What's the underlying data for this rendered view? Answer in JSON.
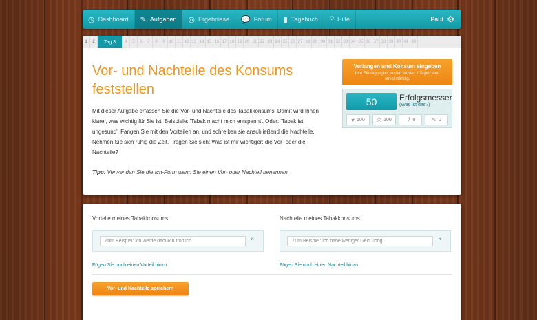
{
  "nav": {
    "items": [
      {
        "label": "Dashboard",
        "icon": "clock-icon"
      },
      {
        "label": "Aufgaben",
        "icon": "pencil-icon"
      },
      {
        "label": "Ergebnisse",
        "icon": "target-icon"
      },
      {
        "label": "Forum",
        "icon": "chat-icon"
      },
      {
        "label": "Tagebuch",
        "icon": "book-icon"
      },
      {
        "label": "Hilfe",
        "icon": "question-icon"
      }
    ],
    "active_index": 1,
    "user": "Paul"
  },
  "days": {
    "past": [
      "1",
      "2"
    ],
    "active": "Tag 3",
    "future": [
      "4",
      "5",
      "6",
      "7",
      "8",
      "9",
      "10",
      "11",
      "12",
      "13",
      "14",
      "15",
      "16",
      "17",
      "18",
      "19",
      "20",
      "21",
      "22",
      "23",
      "24",
      "25",
      "26",
      "27",
      "28",
      "29",
      "30",
      "31",
      "32",
      "33",
      "34",
      "35",
      "36",
      "37",
      "38",
      "39",
      "40",
      "41",
      "42"
    ]
  },
  "task": {
    "title": "Vor- und Nachteile des Konsums feststellen",
    "description": "Mit dieser Aufgabe erfassen Sie die Vor- und Nachteile des Tabakkonsums. Damit wird Ihnen klarer, was wichtig für Sie ist. Beispiele: 'Tabak macht mich entspannt'. Oder: 'Tabak ist ungesund'. Fangen Sie mit den Vorteilen an, und schreiben sie anschließend die Nachteile. Nehmen Sie sich ruhig die Zeit. Fragen Sie sich: Was ist mir wichtiger: die Vor- oder die Nachteile?",
    "tip_label": "Tipp:",
    "tip_text": "Verwenden Sie die Ich-Form wenn Sie einen Vor- oder Nachteil benennen."
  },
  "sidebar": {
    "cta_title": "Verlangen und Konsum eingeben",
    "cta_sub": "Ihre Eintragungen zu den letzten 2 Tagen sind unvollständig.",
    "score": "50",
    "score_title": "Erfolgsmesser",
    "score_link": "(Was ist das?)",
    "stats": [
      {
        "icon": "heart-icon",
        "value": "100"
      },
      {
        "icon": "target-icon",
        "value": "100"
      },
      {
        "icon": "chart-icon",
        "value": "0"
      },
      {
        "icon": "pencil-icon",
        "value": "0"
      }
    ]
  },
  "form": {
    "pros_title": "Vorteile meines Tabakkonsums",
    "pros_placeholder": "Zum Beispiel: ich werde dadurch fröhlich",
    "pros_add": "Fügen Sie noch einen Vorteil hinzu",
    "cons_title": "Nachteile meines Tabakkonsums",
    "cons_placeholder": "Zum Beispiel: ich habe weniger Geld übrig",
    "cons_add": "Fügen Sie noch einen Nachteil hinzu",
    "remove_symbol": "×",
    "save_label": "Vor- und Nachteile speichern"
  },
  "colors": {
    "teal": "#129aa7",
    "orange": "#f2951b"
  }
}
